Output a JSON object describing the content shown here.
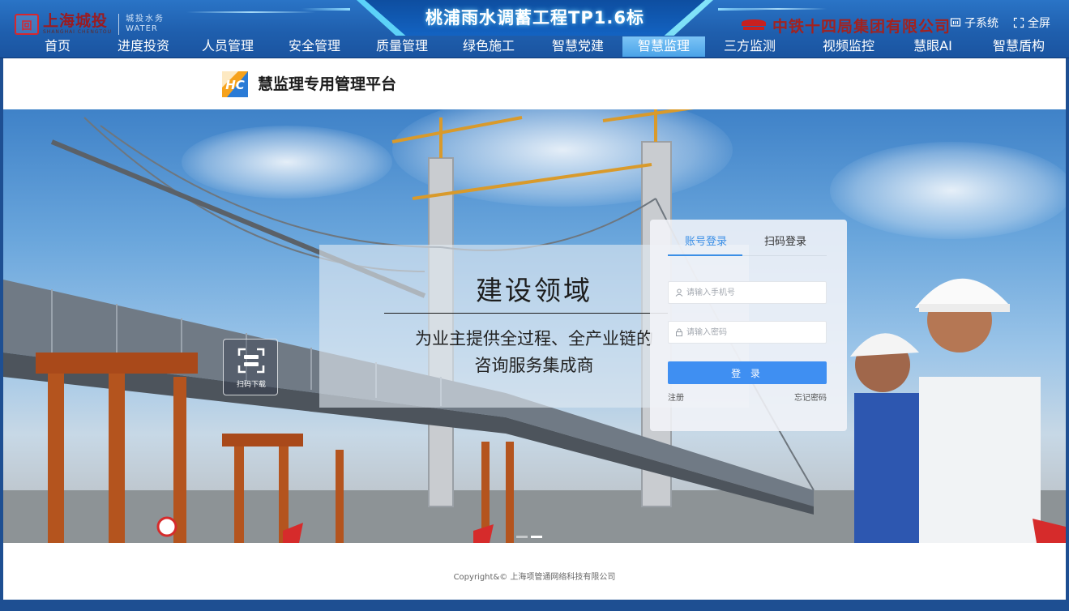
{
  "header": {
    "brand_left": {
      "name": "上海城投",
      "name_en": "SHANGHAI CHENGTOU",
      "sub": "城投水务",
      "sub_en": "WATER"
    },
    "project_title": "桃浦雨水调蓄工程TP1.6标",
    "company_name": "中铁十四局集团有限公司",
    "tools": {
      "subsystem": "子系统",
      "fullscreen": "全屏"
    },
    "nav": [
      {
        "label": "首页"
      },
      {
        "label": "进度投资"
      },
      {
        "label": "人员管理"
      },
      {
        "label": "安全管理"
      },
      {
        "label": "质量管理"
      },
      {
        "label": "绿色施工"
      },
      {
        "label": "智慧党建"
      },
      {
        "label": "智慧监理"
      },
      {
        "label": "三方监测"
      },
      {
        "label": "视频监控"
      },
      {
        "label": "慧眼AI"
      },
      {
        "label": "智慧盾构"
      }
    ],
    "active_nav": "智慧监理"
  },
  "platform": {
    "title": "慧监理专用管理平台"
  },
  "hero": {
    "slogan_title": "建设领域",
    "slogan_line1": "为业主提供全过程、全产业链的",
    "slogan_line2": "咨询服务集成商",
    "qr_label": "扫码下载",
    "carousel": {
      "count": 2,
      "active": 2
    }
  },
  "login": {
    "tab_account": "账号登录",
    "tab_qr": "扫码登录",
    "phone": {
      "value": "",
      "placeholder": "请输入手机号"
    },
    "password": {
      "value": "",
      "placeholder": "请输入密码"
    },
    "submit_label": "登 录",
    "register_label": "注册",
    "forgot_label": "忘记密码"
  },
  "footer": {
    "copyright": "Copyright&© 上海项管通网络科技有限公司"
  },
  "colors": {
    "header_blue": "#1f5fae",
    "nav_active": "#5aaeeb",
    "accent": "#3f8ff2",
    "brand_red": "#a2221f"
  }
}
